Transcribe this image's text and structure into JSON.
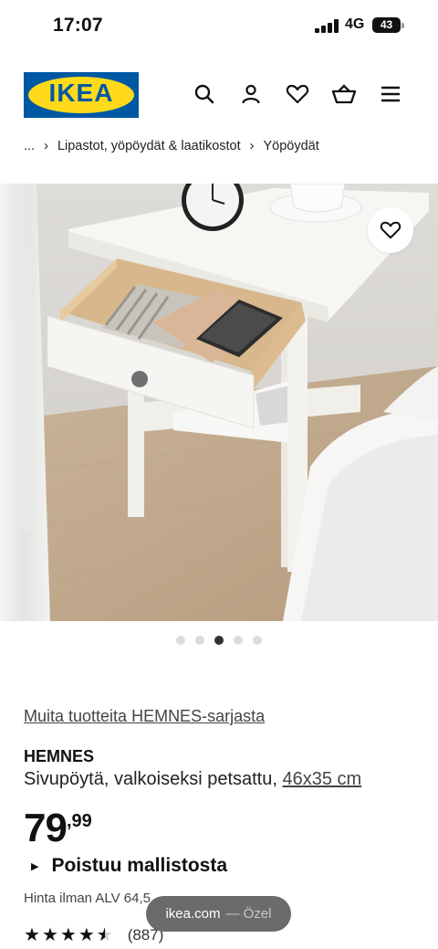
{
  "status_bar": {
    "time": "17:07",
    "network": "4G",
    "battery": "43"
  },
  "header": {
    "logo_text": "IKEA",
    "icons": [
      "search-icon",
      "profile-icon",
      "heart-icon",
      "cart-icon",
      "menu-icon"
    ]
  },
  "breadcrumb": {
    "ellipsis": "...",
    "items": [
      "Lipastot, yöpöydät & laatikostot",
      "Yöpöydät"
    ]
  },
  "gallery": {
    "dot_count": 5,
    "active_index": 2
  },
  "product": {
    "series_link": "Muita tuotteita HEMNES-sarjasta",
    "name": "HEMNES",
    "description": "Sivupöytä, valkoiseksi petsattu,",
    "size_link": "46x35 cm",
    "price_integer": "79",
    "price_decimal": ",99",
    "status": "Poistuu mallistosta",
    "vat_text": "Hinta ilman ALV 64,5",
    "rating_value": 4.5,
    "review_count": "(887)"
  },
  "url_bar": {
    "domain": "ikea.com",
    "suffix": "— Özel"
  },
  "colors": {
    "ikea_blue": "#0058a3",
    "ikea_yellow": "#ffda1a"
  }
}
